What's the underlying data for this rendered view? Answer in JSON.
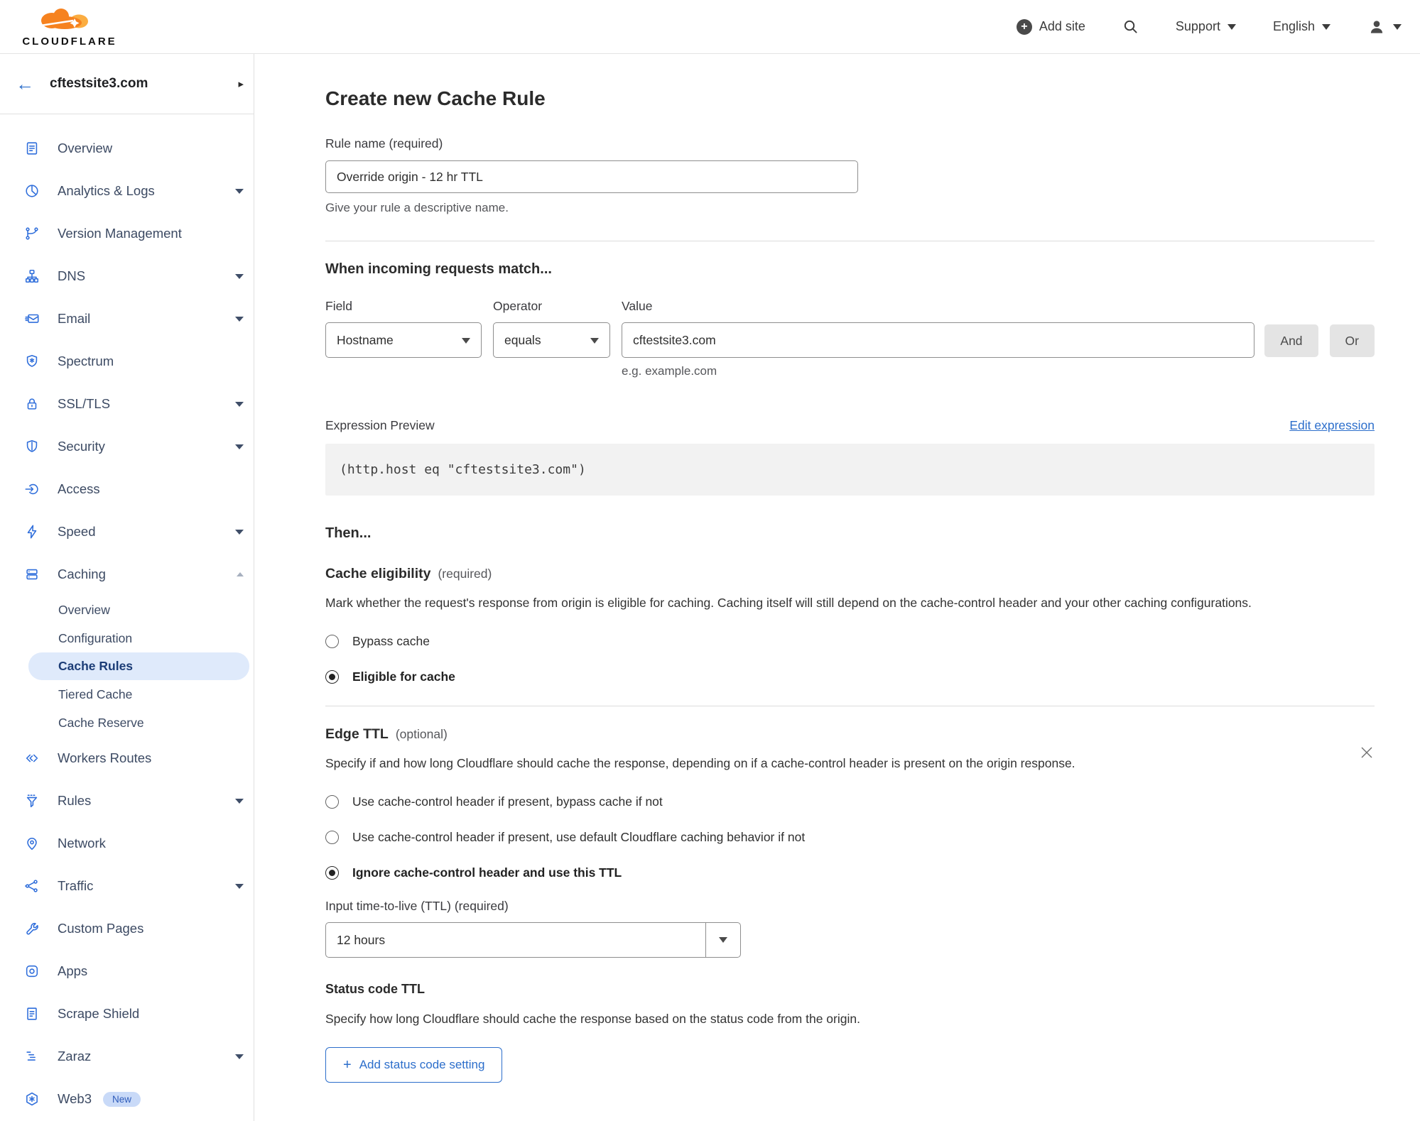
{
  "header": {
    "brand": "CLOUDFLARE",
    "add_site": "Add site",
    "support": "Support",
    "language": "English"
  },
  "sidebar": {
    "site_name": "cftestsite3.com",
    "items": [
      {
        "label": "Overview",
        "icon": "overview-icon"
      },
      {
        "label": "Analytics & Logs",
        "icon": "analytics-icon",
        "expandable": true
      },
      {
        "label": "Version Management",
        "icon": "version-icon"
      },
      {
        "label": "DNS",
        "icon": "dns-icon",
        "expandable": true
      },
      {
        "label": "Email",
        "icon": "email-icon",
        "expandable": true
      },
      {
        "label": "Spectrum",
        "icon": "spectrum-icon"
      },
      {
        "label": "SSL/TLS",
        "icon": "ssl-icon",
        "expandable": true
      },
      {
        "label": "Security",
        "icon": "security-icon",
        "expandable": true
      },
      {
        "label": "Access",
        "icon": "access-icon"
      },
      {
        "label": "Speed",
        "icon": "speed-icon",
        "expandable": true
      },
      {
        "label": "Caching",
        "icon": "caching-icon",
        "expanded": true
      }
    ],
    "caching_children": [
      {
        "label": "Overview",
        "active": false
      },
      {
        "label": "Configuration",
        "active": false
      },
      {
        "label": "Cache Rules",
        "active": true
      },
      {
        "label": "Tiered Cache",
        "active": false
      },
      {
        "label": "Cache Reserve",
        "active": false
      }
    ],
    "items_after": [
      {
        "label": "Workers Routes",
        "icon": "workers-routes-icon"
      },
      {
        "label": "Rules",
        "icon": "rules-icon",
        "expandable": true
      },
      {
        "label": "Network",
        "icon": "network-icon"
      },
      {
        "label": "Traffic",
        "icon": "traffic-icon",
        "expandable": true
      },
      {
        "label": "Custom Pages",
        "icon": "custom-pages-icon"
      },
      {
        "label": "Apps",
        "icon": "apps-icon"
      },
      {
        "label": "Scrape Shield",
        "icon": "scrape-shield-icon"
      },
      {
        "label": "Zaraz",
        "icon": "zaraz-icon",
        "expandable": true
      },
      {
        "label": "Web3",
        "icon": "web3-icon",
        "badge": "New"
      }
    ]
  },
  "main": {
    "title": "Create new Cache Rule",
    "rule_name": {
      "label": "Rule name (required)",
      "value": "Override origin - 12 hr TTL",
      "helper": "Give your rule a descriptive name."
    },
    "match": {
      "heading": "When incoming requests match...",
      "field": {
        "label": "Field",
        "value": "Hostname"
      },
      "operator": {
        "label": "Operator",
        "value": "equals"
      },
      "value": {
        "label": "Value",
        "value": "cftestsite3.com",
        "helper": "e.g. example.com"
      },
      "and_label": "And",
      "or_label": "Or"
    },
    "expression": {
      "label": "Expression Preview",
      "edit_link": "Edit expression",
      "code": "(http.host eq \"cftestsite3.com\")"
    },
    "then_heading": "Then...",
    "eligibility": {
      "heading": "Cache eligibility",
      "required_tag": "(required)",
      "description": "Mark whether the request's response from origin is eligible for caching. Caching itself will still depend on the cache-control header and your other caching configurations.",
      "options": [
        {
          "label": "Bypass cache",
          "selected": false
        },
        {
          "label": "Eligible for cache",
          "selected": true
        }
      ]
    },
    "edge_ttl": {
      "heading": "Edge TTL",
      "optional_tag": "(optional)",
      "description": "Specify if and how long Cloudflare should cache the response, depending on if a cache-control header is present on the origin response.",
      "options": [
        {
          "label": "Use cache-control header if present, bypass cache if not",
          "selected": false
        },
        {
          "label": "Use cache-control header if present, use default Cloudflare caching behavior if not",
          "selected": false
        },
        {
          "label": "Ignore cache-control header and use this TTL",
          "selected": true
        }
      ],
      "ttl": {
        "label": "Input time-to-live (TTL) (required)",
        "value": "12 hours"
      }
    },
    "status_ttl": {
      "heading": "Status code TTL",
      "description": "Specify how long Cloudflare should cache the response based on the status code from the origin.",
      "add_button": "Add status code setting"
    }
  },
  "colors": {
    "accent_blue": "#2c6ecb",
    "nav_icon_blue": "#2f6edb",
    "active_pill_bg": "#dfeafb",
    "brand_orange": "#f6821f",
    "brand_orange_light": "#fbad41",
    "code_bg": "#f2f2f2"
  }
}
